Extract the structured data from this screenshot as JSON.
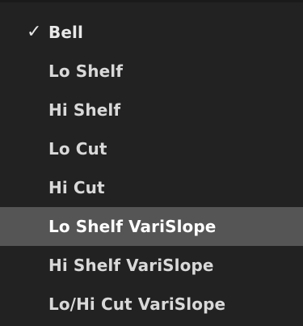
{
  "menu": {
    "check_glyph": "✓",
    "colors": {
      "background": "#222222",
      "highlight": "#555555",
      "text": "#d9d9d9"
    },
    "items": [
      {
        "label": "Bell",
        "checked": true,
        "highlighted": false
      },
      {
        "label": "Lo Shelf",
        "checked": false,
        "highlighted": false
      },
      {
        "label": "Hi Shelf",
        "checked": false,
        "highlighted": false
      },
      {
        "label": "Lo Cut",
        "checked": false,
        "highlighted": false
      },
      {
        "label": "Hi Cut",
        "checked": false,
        "highlighted": false
      },
      {
        "label": "Lo Shelf VariSlope",
        "checked": false,
        "highlighted": true
      },
      {
        "label": "Hi Shelf VariSlope",
        "checked": false,
        "highlighted": false
      },
      {
        "label": "Lo/Hi Cut VariSlope",
        "checked": false,
        "highlighted": false
      }
    ]
  }
}
